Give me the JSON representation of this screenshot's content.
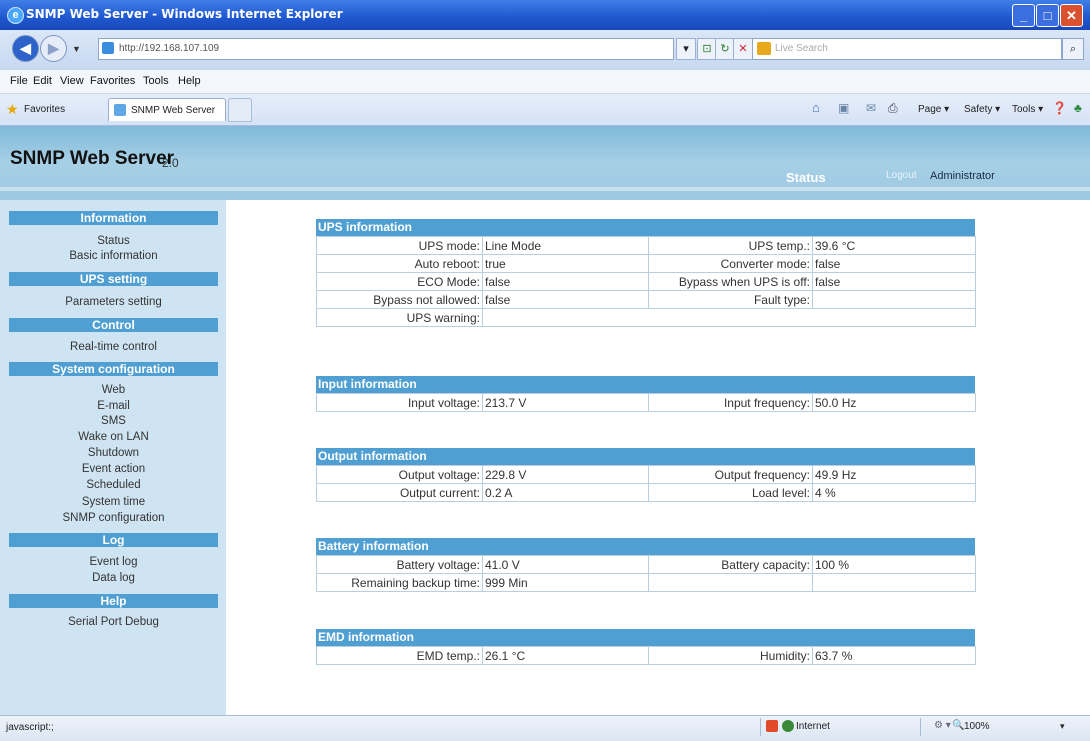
{
  "window": {
    "title": "SNMP Web Server - Windows Internet Explorer",
    "url": "http://192.168.107.109",
    "search_placeholder": "Live Search"
  },
  "menu": [
    "File",
    "Edit",
    "View",
    "Favorites",
    "Tools",
    "Help"
  ],
  "favorites": {
    "label": "Favorites",
    "tab": "SNMP Web Server"
  },
  "commands": {
    "page": "Page ▾",
    "safety": "Safety ▾",
    "tools": "Tools ▾"
  },
  "header": {
    "title": "SNMP Web Server",
    "version": "2.0",
    "active_tab": "Status",
    "logout": "Logout",
    "user": "Administrator"
  },
  "sidebar": {
    "sections": [
      {
        "title": "Information",
        "items": [
          "Status",
          "Basic information"
        ]
      },
      {
        "title": "UPS setting",
        "items": [
          "Parameters setting"
        ]
      },
      {
        "title": "Control",
        "items": [
          "Real-time control"
        ]
      },
      {
        "title": "System configuration",
        "items": [
          "Web",
          "E-mail",
          "SMS",
          "Wake on LAN",
          "Shutdown",
          "Event action",
          "Scheduled",
          "System time",
          "SNMP configuration"
        ]
      },
      {
        "title": "Log",
        "items": [
          "Event log",
          "Data log"
        ]
      },
      {
        "title": "Help",
        "items": [
          "Serial Port Debug"
        ]
      }
    ]
  },
  "ups": {
    "title": "UPS information",
    "rows": [
      [
        "UPS mode:",
        "Line Mode",
        "UPS temp.:",
        "39.6 °C"
      ],
      [
        "Auto reboot:",
        "true",
        "Converter mode:",
        "false"
      ],
      [
        "ECO Mode:",
        "false",
        "Bypass when UPS is off:",
        "false"
      ],
      [
        "Bypass not allowed:",
        "false",
        "Fault type:",
        ""
      ]
    ],
    "warning_label": "UPS warning:",
    "warning_value": ""
  },
  "input": {
    "title": "Input information",
    "rows": [
      [
        "Input voltage:",
        "213.7 V",
        "Input frequency:",
        "50.0 Hz"
      ]
    ]
  },
  "output": {
    "title": "Output information",
    "rows": [
      [
        "Output voltage:",
        "229.8 V",
        "Output frequency:",
        "49.9 Hz"
      ],
      [
        "Output current:",
        "0.2 A",
        "Load level:",
        "4 %"
      ]
    ]
  },
  "battery": {
    "title": "Battery information",
    "rows": [
      [
        "Battery voltage:",
        "41.0 V",
        "Battery capacity:",
        "100 %"
      ],
      [
        "Remaining backup time:",
        "999 Min",
        "",
        ""
      ]
    ]
  },
  "emd": {
    "title": "EMD information",
    "rows": [
      [
        "EMD temp.:",
        "26.1 °C",
        "Humidity:",
        "63.7 %"
      ]
    ]
  },
  "statusbar": {
    "text": "javascript:;",
    "zone": "Internet",
    "zoom": "100%"
  }
}
